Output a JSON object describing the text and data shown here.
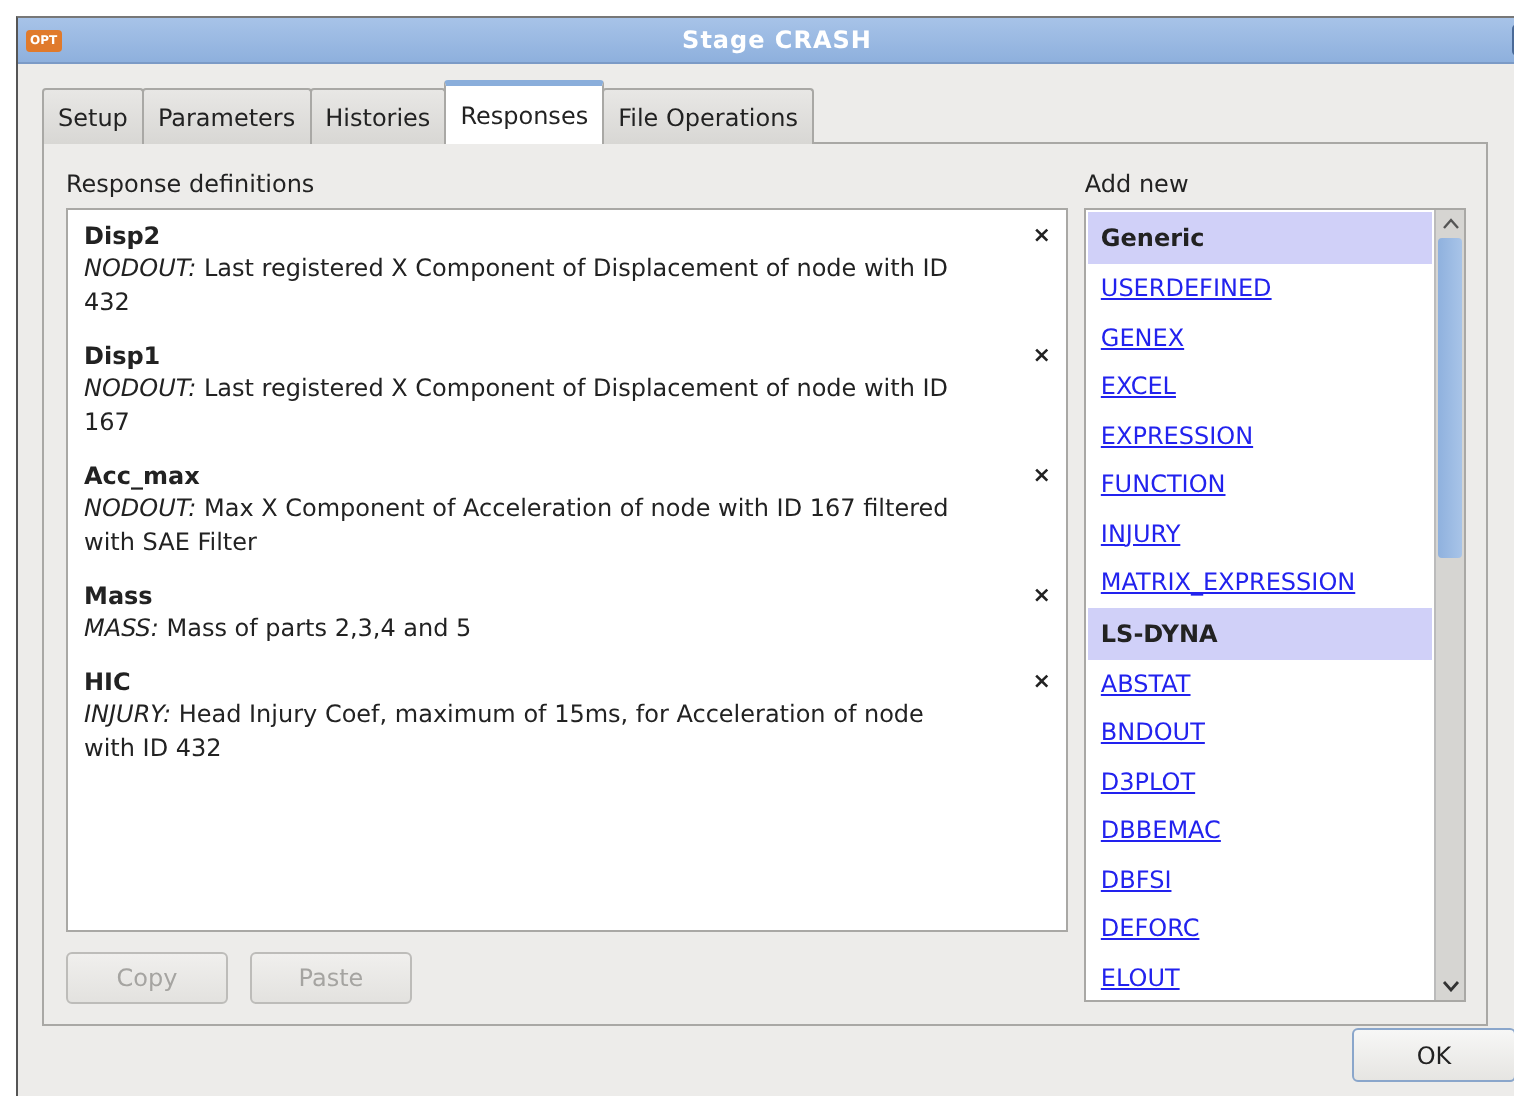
{
  "window": {
    "title": "Stage CRASH",
    "icon_text": "OPT"
  },
  "tabs": [
    {
      "label": "Setup",
      "selected": false
    },
    {
      "label": "Parameters",
      "selected": false
    },
    {
      "label": "Histories",
      "selected": false
    },
    {
      "label": "Responses",
      "selected": true
    },
    {
      "label": "File Operations",
      "selected": false
    }
  ],
  "responses": {
    "label": "Response definitions",
    "items": [
      {
        "name": "Disp2",
        "type": "NODOUT:",
        "description": "Last registered X Component of Displacement of node with ID 432",
        "remove": "×"
      },
      {
        "name": "Disp1",
        "type": "NODOUT:",
        "description": "Last registered X Component of Displacement of node with ID 167",
        "remove": "×"
      },
      {
        "name": "Acc_max",
        "type": "NODOUT:",
        "description": "Max X Component of Acceleration of node with ID 167 filtered with SAE Filter",
        "remove": "×"
      },
      {
        "name": "Mass",
        "type": "MASS:",
        "description": "Mass of parts 2,3,4 and 5",
        "remove": "×"
      },
      {
        "name": "HIC",
        "type": "INJURY:",
        "description": "Head Injury Coef, maximum of 15ms, for Acceleration of node with ID 432",
        "remove": "×"
      }
    ]
  },
  "buttons": [
    {
      "label": "Copy",
      "disabled": true
    },
    {
      "label": "Paste",
      "disabled": true
    }
  ],
  "add_new": {
    "label": "Add new",
    "items": [
      {
        "kind": "header",
        "label": "Generic"
      },
      {
        "kind": "link",
        "label": "USERDEFINED"
      },
      {
        "kind": "link",
        "label": "GENEX"
      },
      {
        "kind": "link",
        "label": "EXCEL"
      },
      {
        "kind": "link",
        "label": "EXPRESSION"
      },
      {
        "kind": "link",
        "label": "FUNCTION"
      },
      {
        "kind": "link",
        "label": "INJURY"
      },
      {
        "kind": "link",
        "label": "MATRIX_EXPRESSION"
      },
      {
        "kind": "header",
        "label": "LS-DYNA"
      },
      {
        "kind": "link",
        "label": "ABSTAT"
      },
      {
        "kind": "link",
        "label": "BNDOUT"
      },
      {
        "kind": "link",
        "label": "D3PLOT"
      },
      {
        "kind": "link",
        "label": "DBBEMAC"
      },
      {
        "kind": "link",
        "label": "DBFSI"
      },
      {
        "kind": "link",
        "label": "DEFORC"
      },
      {
        "kind": "link",
        "label": "ELOUT"
      }
    ]
  },
  "ok_button": {
    "label": "OK"
  }
}
